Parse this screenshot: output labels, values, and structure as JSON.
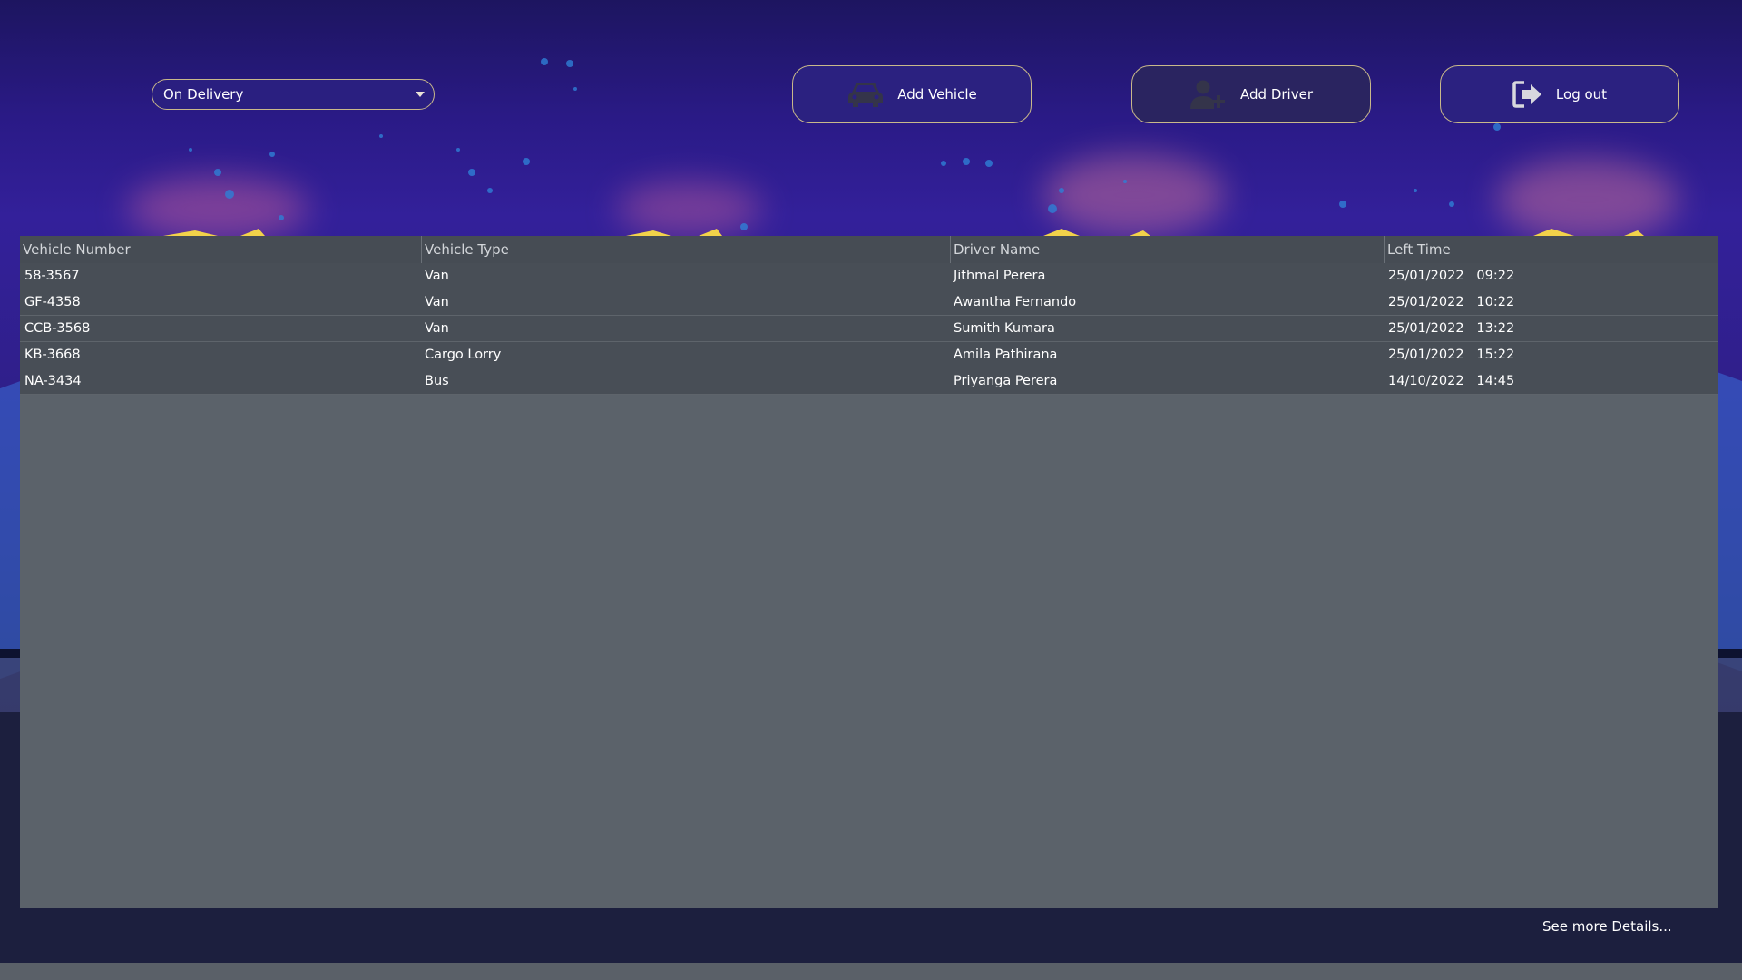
{
  "app": {
    "filter_dropdown": {
      "selected": "On Delivery"
    },
    "buttons": {
      "add_vehicle": {
        "label": "Add Vehicle",
        "icon": "car-icon"
      },
      "add_driver": {
        "label": "Add Driver",
        "icon": "add-user-icon"
      },
      "logout": {
        "label": "Log out",
        "icon": "logout-icon"
      }
    },
    "colors": {
      "accent_border": "#c9b98a",
      "table_bg": "#5b626a",
      "table_row": "#484e56",
      "background": "#2a1a86"
    }
  },
  "table": {
    "columns": [
      "Vehicle Number",
      "Vehicle Type",
      "Driver Name",
      "Left Time"
    ],
    "rows": [
      {
        "vehicle_number": "58-3567",
        "vehicle_type": "Van",
        "driver_name": "Jithmal Perera",
        "left_time": "25/01/2022   09:22"
      },
      {
        "vehicle_number": "GF-4358",
        "vehicle_type": "Van",
        "driver_name": "Awantha Fernando",
        "left_time": "25/01/2022   10:22"
      },
      {
        "vehicle_number": "CCB-3568",
        "vehicle_type": "Van",
        "driver_name": "Sumith Kumara",
        "left_time": "25/01/2022   13:22"
      },
      {
        "vehicle_number": "KB-3668",
        "vehicle_type": "Cargo Lorry",
        "driver_name": "Amila Pathirana",
        "left_time": "25/01/2022   15:22"
      },
      {
        "vehicle_number": "NA-3434",
        "vehicle_type": "Bus",
        "driver_name": "Priyanga Perera",
        "left_time": "14/10/2022   14:45"
      }
    ]
  },
  "footer": {
    "see_more": "See more Details..."
  }
}
